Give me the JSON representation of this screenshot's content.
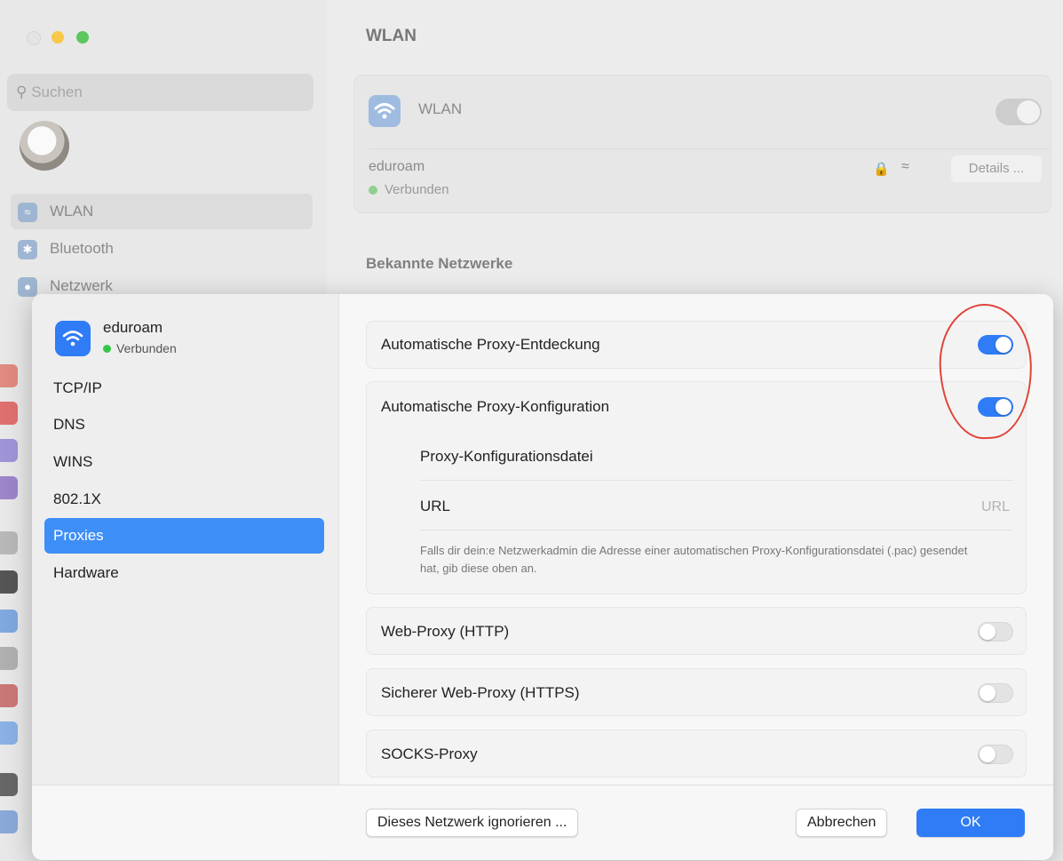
{
  "background": {
    "title": "WLAN",
    "search_placeholder": "Suchen",
    "sidebar_items": [
      {
        "label": "WLAN",
        "icon": "wifi-icon",
        "selected": true
      },
      {
        "label": "Bluetooth",
        "icon": "bluetooth-icon",
        "selected": false
      },
      {
        "label": "Netzwerk",
        "icon": "globe-icon",
        "selected": false
      }
    ],
    "wlan_card": {
      "label": "WLAN",
      "network_name": "eduroam",
      "network_status": "Verbunden",
      "details_button": "Details ..."
    },
    "known_networks": "Bekannte Netzwerke"
  },
  "sheet": {
    "network": {
      "name": "eduroam",
      "status": "Verbunden"
    },
    "tabs": [
      {
        "label": "TCP/IP",
        "selected": false
      },
      {
        "label": "DNS",
        "selected": false
      },
      {
        "label": "WINS",
        "selected": false
      },
      {
        "label": "802.1X",
        "selected": false
      },
      {
        "label": "Proxies",
        "selected": true
      },
      {
        "label": "Hardware",
        "selected": false
      }
    ],
    "auto_discovery": {
      "label": "Automatische Proxy-Entdeckung",
      "enabled": true
    },
    "auto_config": {
      "label": "Automatische Proxy-Konfiguration",
      "enabled": true,
      "file_label": "Proxy-Konfigurationsdatei",
      "url_label": "URL",
      "url_placeholder": "URL",
      "url_value": "",
      "hint": "Falls dir dein:e Netzwerkadmin die Adresse einer automatischen Proxy-Konfigurationsdatei (.pac) gesendet hat, gib diese oben an."
    },
    "proxies": [
      {
        "label": "Web-Proxy (HTTP)",
        "enabled": false
      },
      {
        "label": "Sicherer Web-Proxy (HTTPS)",
        "enabled": false
      },
      {
        "label": "SOCKS-Proxy",
        "enabled": false
      }
    ],
    "footer": {
      "ignore_button": "Dieses Netzwerk ignorieren ...",
      "cancel_button": "Abbrechen",
      "ok_button": "OK"
    }
  },
  "colors": {
    "accent": "#2f7cf6",
    "connected": "#33c748",
    "annotation": "#e0453a"
  }
}
